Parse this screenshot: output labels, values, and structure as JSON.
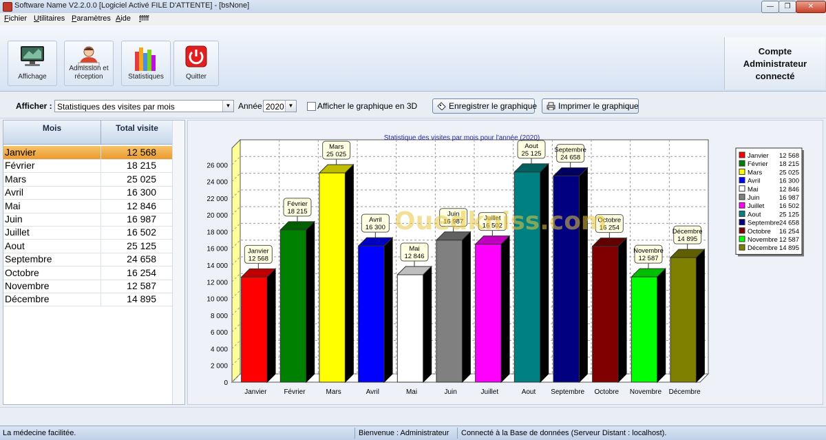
{
  "window": {
    "title": "Software Name V2.2.0.0 [Logiciel Activé FILE D'ATTENTE] - [bsNone]",
    "controls": [
      "—",
      "❐",
      "✕"
    ]
  },
  "menu": [
    "Fichier",
    "Utilitaires",
    "Paramètres",
    "Aide",
    "fffff"
  ],
  "toolbar": {
    "buttons": [
      {
        "label": "Affichage",
        "icon": "monitor-icon"
      },
      {
        "label": "Admission et réception",
        "icon": "receptionist-icon"
      },
      {
        "label": "Statistiques",
        "icon": "books-chart-icon"
      },
      {
        "label": "Quitter",
        "icon": "power-icon"
      }
    ],
    "account_lines": [
      "Compte",
      "Administrateur",
      "connecté"
    ]
  },
  "filter": {
    "afficher_label": "Afficher :",
    "afficher_value": "Statistiques des visites par mois",
    "annee_label": "Année",
    "annee_value": "2020",
    "chk_3d_label": "Afficher le graphique en 3D",
    "save_button": "Enregistrer le graphique",
    "print_button": "Imprimer le graphique"
  },
  "table": {
    "headers": [
      "Mois",
      "Total visite"
    ],
    "rows": [
      [
        "Janvier",
        "12 568"
      ],
      [
        "Février",
        "18 215"
      ],
      [
        "Mars",
        "25 025"
      ],
      [
        "Avril",
        "16 300"
      ],
      [
        "Mai",
        "12 846"
      ],
      [
        "Juin",
        "16 987"
      ],
      [
        "Juillet",
        "16 502"
      ],
      [
        "Aout",
        "25 125"
      ],
      [
        "Septembre",
        "24 658"
      ],
      [
        "Octobre",
        "16 254"
      ],
      [
        "Novembre",
        "12 587"
      ],
      [
        "Décembre",
        "14 895"
      ]
    ],
    "selected_row": 0
  },
  "chart_data": {
    "type": "bar",
    "title": "Statistique des visites par mois pour l'année (2020)",
    "categories": [
      "Janvier",
      "Février",
      "Mars",
      "Avril",
      "Mai",
      "Juin",
      "Juillet",
      "Aout",
      "Septembre",
      "Octobre",
      "Novembre",
      "Décembre"
    ],
    "values": [
      12568,
      18215,
      25025,
      16300,
      12846,
      16987,
      16502,
      25125,
      24658,
      16254,
      12587,
      14895
    ],
    "value_labels": [
      "12 568",
      "18 215",
      "25 025",
      "16 300",
      "12 846",
      "16 987",
      "16 502",
      "25 125",
      "24 658",
      "16 254",
      "12 587",
      "14 895"
    ],
    "colors": [
      "#ff0000",
      "#008000",
      "#ffff00",
      "#0000ff",
      "#ffffff",
      "#808080",
      "#ff00ff",
      "#008080",
      "#000080",
      "#800000",
      "#00ff00",
      "#808000"
    ],
    "ylim": [
      0,
      28000
    ],
    "yticks": [
      "0",
      "2 000",
      "4 000",
      "6 000",
      "8 000",
      "10 000",
      "12 000",
      "14 000",
      "16 000",
      "18 000",
      "20 000",
      "22 000",
      "24 000",
      "26 000"
    ],
    "ytick_values": [
      0,
      2000,
      4000,
      6000,
      8000,
      10000,
      12000,
      14000,
      16000,
      18000,
      20000,
      22000,
      24000,
      26000
    ],
    "three_d": true,
    "grid": true,
    "legend_position": "right"
  },
  "watermark": "Ouedkniss.com",
  "status": {
    "left": "La médecine facilitée.",
    "middle": "Bienvenue : Administrateur",
    "right": "Connecté à la Base de données (Serveur Distant : localhost)."
  }
}
